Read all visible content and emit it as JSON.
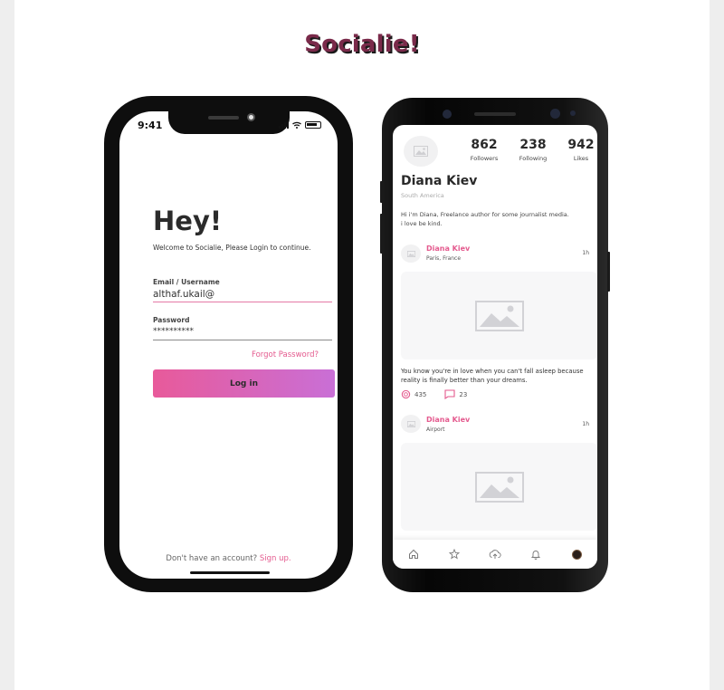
{
  "app": {
    "title": "Socialie!"
  },
  "login": {
    "status_time": "9:41",
    "heading": "Hey!",
    "subtitle": "Welcome to Socialie, Please Login to continue.",
    "email_label": "Email / Username",
    "email_value": "althaf.ukail@",
    "password_label": "Password",
    "password_value": "**********",
    "forgot_label": "Forgot Password?",
    "login_button": "Log in",
    "signup_prompt": "Don't have an account?",
    "signup_link": "Sign up."
  },
  "profile": {
    "stats": [
      {
        "value": "862",
        "label": "Followers"
      },
      {
        "value": "238",
        "label": "Following"
      },
      {
        "value": "942",
        "label": "Likes"
      }
    ],
    "name": "Diana Kiev",
    "location": "South America",
    "bio_line1": "Hi i'm Diana, Freelance author for some journalist media.",
    "bio_line2": "i love be kind."
  },
  "posts": [
    {
      "author": "Diana Kiev",
      "place": "Paris, France",
      "time": "1h",
      "text_line1": "You know you're in love when you can't fall asleep because",
      "text_line2": "reality is finally better than your dreams.",
      "likes": "435",
      "comments": "23"
    },
    {
      "author": "Diana Kiev",
      "place": "Airport",
      "time": "1h"
    }
  ],
  "nav": [
    "home-icon",
    "star-icon",
    "upload-cloud-icon",
    "bell-icon",
    "profile-avatar"
  ],
  "colors": {
    "accent": "#e45a8e",
    "title": "#7a2a4a",
    "gradient_start": "#e85a9a",
    "gradient_end": "#c96fd6"
  }
}
